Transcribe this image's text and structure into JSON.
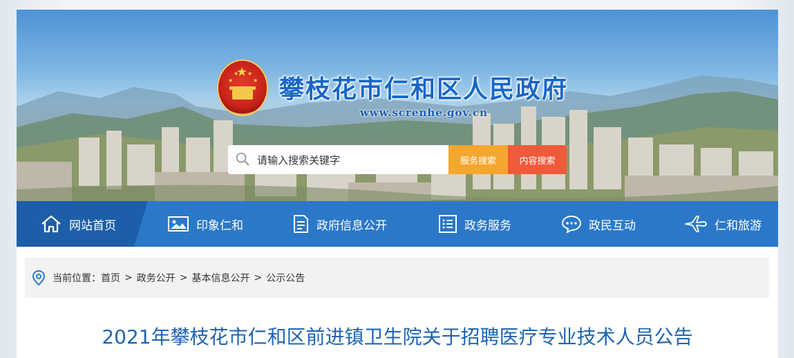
{
  "header": {
    "site_title": "攀枝花市仁和区人民政府",
    "site_url": "www.screnhe.gov.cn"
  },
  "search": {
    "placeholder": "请输入搜索关键字",
    "service_button": "服务搜索",
    "content_button": "内容搜索"
  },
  "nav": {
    "items": [
      {
        "label": "网站首页",
        "icon": "home-icon"
      },
      {
        "label": "印象仁和",
        "icon": "image-icon"
      },
      {
        "label": "政府信息公开",
        "icon": "document-icon"
      },
      {
        "label": "政务服务",
        "icon": "list-icon"
      },
      {
        "label": "政民互动",
        "icon": "chat-icon"
      },
      {
        "label": "仁和旅游",
        "icon": "plane-icon"
      }
    ]
  },
  "breadcrumb": {
    "prefix": "当前位置：",
    "items": [
      "首页",
      "政务公开",
      "基本信息公开",
      "公示公告"
    ],
    "separator": ">"
  },
  "article": {
    "title": "2021年攀枝花市仁和区前进镇卫生院关于招聘医疗专业技术人员公告"
  },
  "colors": {
    "nav_bg": "#2b78c9",
    "nav_active": "#1d5ea9",
    "title_blue": "#1f64b0",
    "service_btn": "#f4a72e",
    "content_btn": "#ef5a3b"
  }
}
